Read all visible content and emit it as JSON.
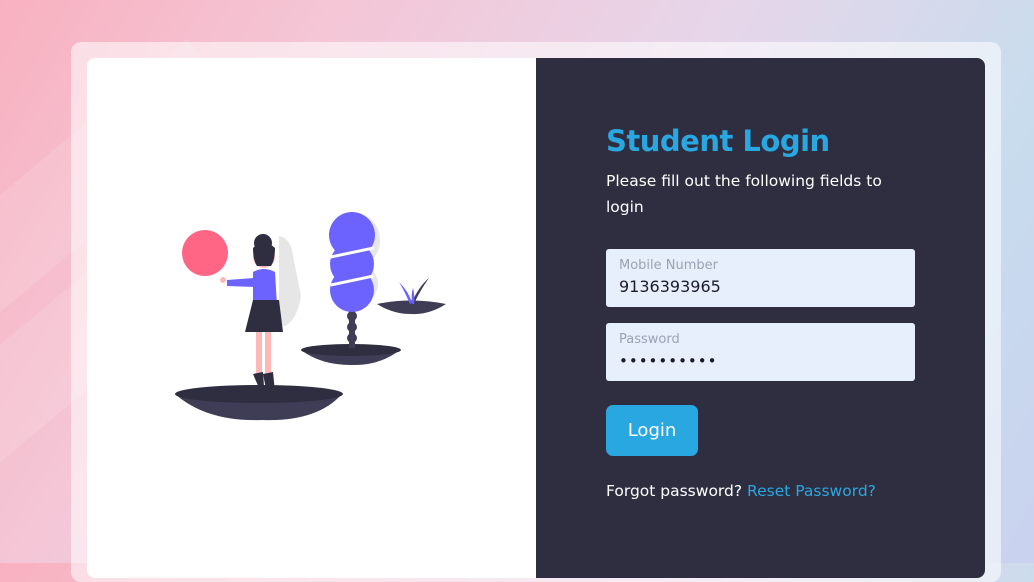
{
  "login": {
    "title": "Student Login",
    "subtitle": "Please fill out the following fields to login",
    "mobile": {
      "label": "Mobile Number",
      "value": "9136393965"
    },
    "password": {
      "label": "Password",
      "value": "••••••••••"
    },
    "button_label": "Login",
    "forgot_text": "Forgot password?",
    "reset_link": "Reset Password?"
  },
  "colors": {
    "accent": "#29a7e1",
    "panel_dark": "#2f2e41",
    "field_bg": "#e8effc",
    "illustration_purple": "#6c63ff",
    "illustration_pink": "#ff6584"
  },
  "illustration": {
    "name": "woman-with-balloon-and-trees-illustration"
  }
}
